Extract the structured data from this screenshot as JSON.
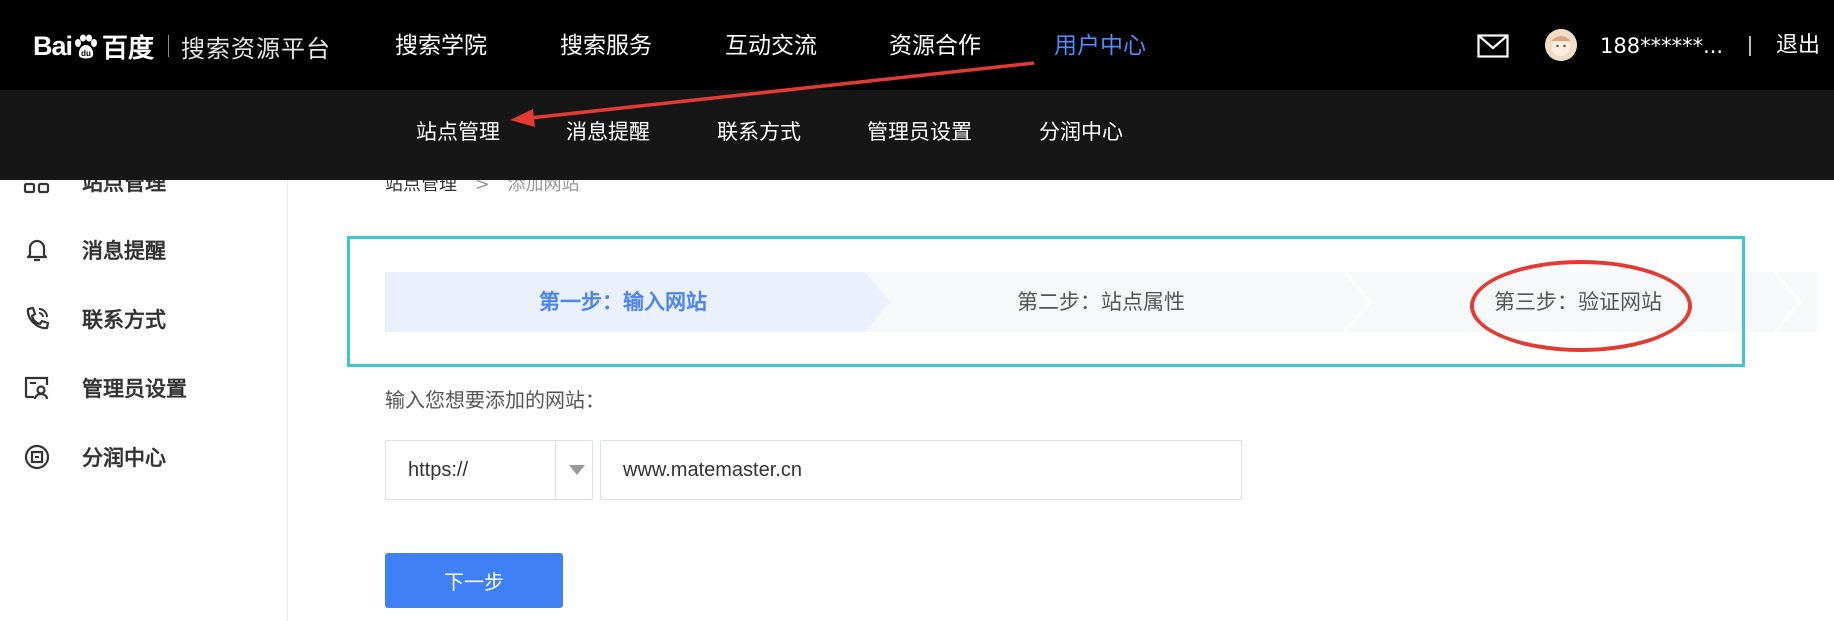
{
  "logo": {
    "mark": "Bai",
    "mark_tail": "百度",
    "subtitle": "搜索资源平台"
  },
  "top_nav": [
    {
      "label": "搜索学院"
    },
    {
      "label": "搜索服务"
    },
    {
      "label": "互动交流"
    },
    {
      "label": "资源合作"
    },
    {
      "label": "用户中心",
      "active": true
    }
  ],
  "header_right": {
    "user": "188******...",
    "separator": "|",
    "logout": "退出"
  },
  "sub_nav": [
    {
      "label": "站点管理"
    },
    {
      "label": "消息提醒"
    },
    {
      "label": "联系方式"
    },
    {
      "label": "管理员设置"
    },
    {
      "label": "分润中心"
    }
  ],
  "sidebar": {
    "items": [
      {
        "label": "站点管理",
        "icon": "site-icon"
      },
      {
        "label": "消息提醒",
        "icon": "bell-icon"
      },
      {
        "label": "联系方式",
        "icon": "phone-icon"
      },
      {
        "label": "管理员设置",
        "icon": "admin-icon"
      },
      {
        "label": "分润中心",
        "icon": "profit-icon"
      }
    ]
  },
  "breadcrumb": {
    "root": "站点管理",
    "sep": ">",
    "current": "添加网站"
  },
  "steps": [
    {
      "label": "第一步：输入网站",
      "active": true
    },
    {
      "label": "第二步：站点属性",
      "active": false
    },
    {
      "label": "第三步：验证网站",
      "active": false
    }
  ],
  "form": {
    "label": "输入您想要添加的网站：",
    "protocol": "https://",
    "url_value": "www.matemaster.cn",
    "next_button": "下一步"
  },
  "colors": {
    "accent": "#3f81f5",
    "nav_active": "#4e8cff",
    "annotation_red": "#e23b34",
    "highlight_box": "#3ec8cc"
  }
}
